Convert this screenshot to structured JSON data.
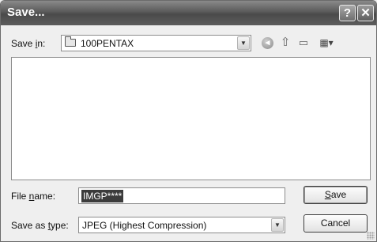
{
  "window": {
    "title": "Save...",
    "help_label": "?",
    "close_label": "✕"
  },
  "save_in": {
    "label_prefix": "Save ",
    "label_mnemonic": "i",
    "label_suffix": "n:",
    "folder_name": "100PENTAX"
  },
  "toolbar": {
    "icons": [
      "back-icon",
      "up-one-level-icon",
      "new-folder-icon",
      "view-menu-icon"
    ]
  },
  "file_name": {
    "label_prefix": "File ",
    "label_mnemonic": "n",
    "label_suffix": "ame:",
    "value": "IMGP****"
  },
  "save_as_type": {
    "label_prefix": "Save as ",
    "label_mnemonic": "t",
    "label_suffix": "ype:",
    "value": "JPEG (Highest Compression)"
  },
  "buttons": {
    "save_mnemonic": "S",
    "save_rest": "ave",
    "cancel": "Cancel"
  }
}
